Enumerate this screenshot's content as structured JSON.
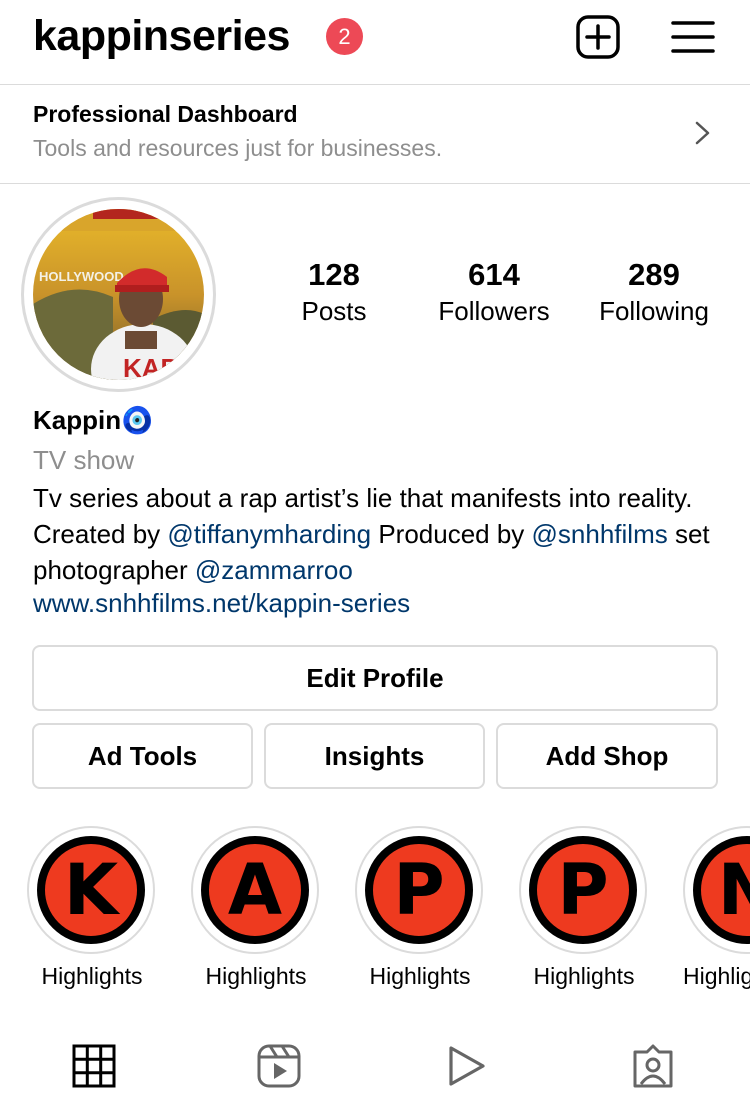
{
  "header": {
    "username": "kappinseries",
    "notification_count": "2",
    "new_post_icon": "plus-square-icon",
    "menu_icon": "hamburger-menu-icon"
  },
  "dashboard": {
    "title": "Professional Dashboard",
    "subtitle": "Tools and resources just for businesses.",
    "chevron_icon": "chevron-right-icon"
  },
  "profile": {
    "avatar_text": "HOLLYWOOD",
    "stats": [
      {
        "value": "128",
        "label": "Posts"
      },
      {
        "value": "614",
        "label": "Followers"
      },
      {
        "value": "289",
        "label": "Following"
      }
    ],
    "name": "Kappin",
    "name_emoji": "🧿",
    "category": "TV show",
    "bio": {
      "line_text_1": "Tv series about a rap artist’s lie that manifests into reality. Created by ",
      "mention_1": "@tiffanymharding",
      "line_text_2": " Produced by ",
      "mention_2": "@snhhfilms",
      "line_text_3": " set photographer ",
      "mention_3": "@zammarroo"
    },
    "website": "www.snhhfilms.net/kappin-series"
  },
  "buttons": {
    "edit_profile": "Edit Profile",
    "ad_tools": "Ad Tools",
    "insights": "Insights",
    "add_shop": "Add Shop"
  },
  "highlights": [
    {
      "letter": "K",
      "label": "Highlights"
    },
    {
      "letter": "A",
      "label": "Highlights"
    },
    {
      "letter": "P",
      "label": "Highlights"
    },
    {
      "letter": "P",
      "label": "Highlights"
    },
    {
      "letter": "N",
      "label": "Highlights"
    }
  ],
  "tabs": [
    {
      "icon": "grid-icon",
      "active": true
    },
    {
      "icon": "reels-icon",
      "active": false
    },
    {
      "icon": "play-icon",
      "active": false
    },
    {
      "icon": "tagged-icon",
      "active": false
    }
  ],
  "colors": {
    "notification": "#ed4956",
    "link": "#00376b",
    "secondary_text": "#8e8e8e",
    "border": "#dbdbdb",
    "highlight_red": "#ee3a1f"
  }
}
